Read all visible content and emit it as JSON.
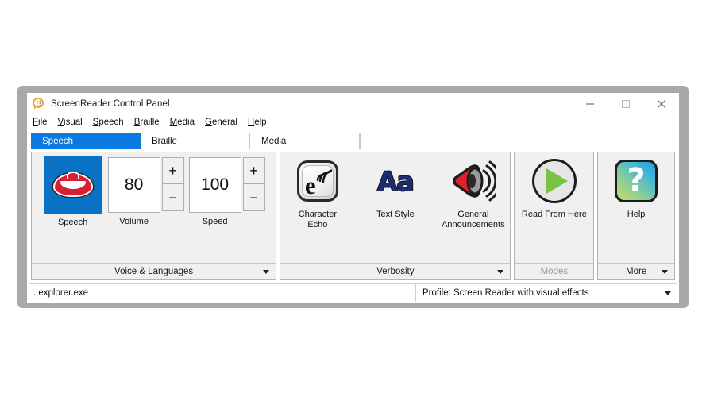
{
  "window": {
    "title": "ScreenReader Control Panel",
    "icon": "speech-bubble-icon",
    "controls": {
      "minimize": "minimize-icon",
      "maximize": "maximize-icon",
      "close": "close-icon"
    }
  },
  "menubar": {
    "items": [
      {
        "label": "File",
        "accel": "F"
      },
      {
        "label": "Visual",
        "accel": "V"
      },
      {
        "label": "Speech",
        "accel": "S"
      },
      {
        "label": "Braille",
        "accel": "B"
      },
      {
        "label": "Media",
        "accel": "M"
      },
      {
        "label": "General",
        "accel": "G"
      },
      {
        "label": "Help",
        "accel": "H"
      }
    ]
  },
  "tabs": [
    {
      "label": "Speech",
      "active": true
    },
    {
      "label": "Braille",
      "active": false
    },
    {
      "label": "Media",
      "active": false
    }
  ],
  "ribbon": {
    "groups": [
      {
        "name": "speech",
        "footer": "Voice & Languages",
        "footer_has_caret": true,
        "footer_disabled": false,
        "items": [
          {
            "type": "tile",
            "caption": "Speech",
            "icon": "lips-icon"
          },
          {
            "type": "spinner",
            "caption": "Volume",
            "value": "80",
            "plus": "+",
            "minus": "−"
          },
          {
            "type": "spinner",
            "caption": "Speed",
            "value": "100",
            "plus": "+",
            "minus": "−"
          }
        ]
      },
      {
        "name": "verbosity",
        "footer": "Verbosity",
        "footer_has_caret": true,
        "footer_disabled": false,
        "items": [
          {
            "type": "tile",
            "caption": "Character\nEcho",
            "icon": "character-echo-icon"
          },
          {
            "type": "tile",
            "caption": "Text Style",
            "icon": "text-style-icon",
            "glyph": "Aa"
          },
          {
            "type": "tile",
            "caption": "General\nAnnouncements",
            "icon": "general-announcements-icon"
          }
        ]
      },
      {
        "name": "modes",
        "footer": "Modes",
        "footer_has_caret": false,
        "footer_disabled": true,
        "items": [
          {
            "type": "tile",
            "caption": "Read From Here",
            "icon": "play-icon"
          }
        ]
      },
      {
        "name": "more",
        "footer": "More",
        "footer_has_caret": true,
        "footer_disabled": false,
        "items": [
          {
            "type": "tile",
            "caption": "Help",
            "icon": "help-icon",
            "glyph": "?"
          }
        ]
      }
    ]
  },
  "statusbar": {
    "left": ". explorer.exe",
    "right": "Profile: Screen Reader with visual effects",
    "right_has_caret": true
  },
  "colors": {
    "accent": "#0a7ae0",
    "frame": "#a9a9a9",
    "group_bg": "#f0f0f0",
    "lips_tile": "#0a72c4",
    "lips_red": "#d81f33",
    "play_green": "#7cc242",
    "aa_blue": "#1d2d73"
  }
}
